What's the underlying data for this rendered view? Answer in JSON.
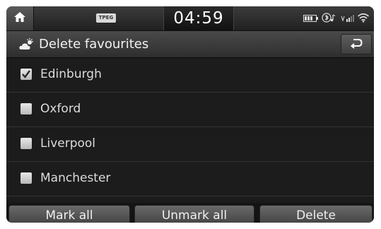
{
  "status_bar": {
    "home_icon": "home-icon",
    "tpeg_label": "TPEG",
    "time": "04:59",
    "icons": [
      "battery-icon",
      "bluetooth-audio-icon",
      "signal-icon",
      "wifi-icon"
    ]
  },
  "title_bar": {
    "icon": "weather-icon",
    "title": "Delete favourites",
    "back_icon": "back-icon"
  },
  "list": {
    "items": [
      {
        "label": "Edinburgh",
        "checked": true
      },
      {
        "label": "Oxford",
        "checked": false
      },
      {
        "label": "Liverpool",
        "checked": false
      },
      {
        "label": "Manchester",
        "checked": false
      }
    ]
  },
  "buttons": {
    "mark_all": "Mark all",
    "unmark_all": "Unmark all",
    "delete": "Delete"
  }
}
